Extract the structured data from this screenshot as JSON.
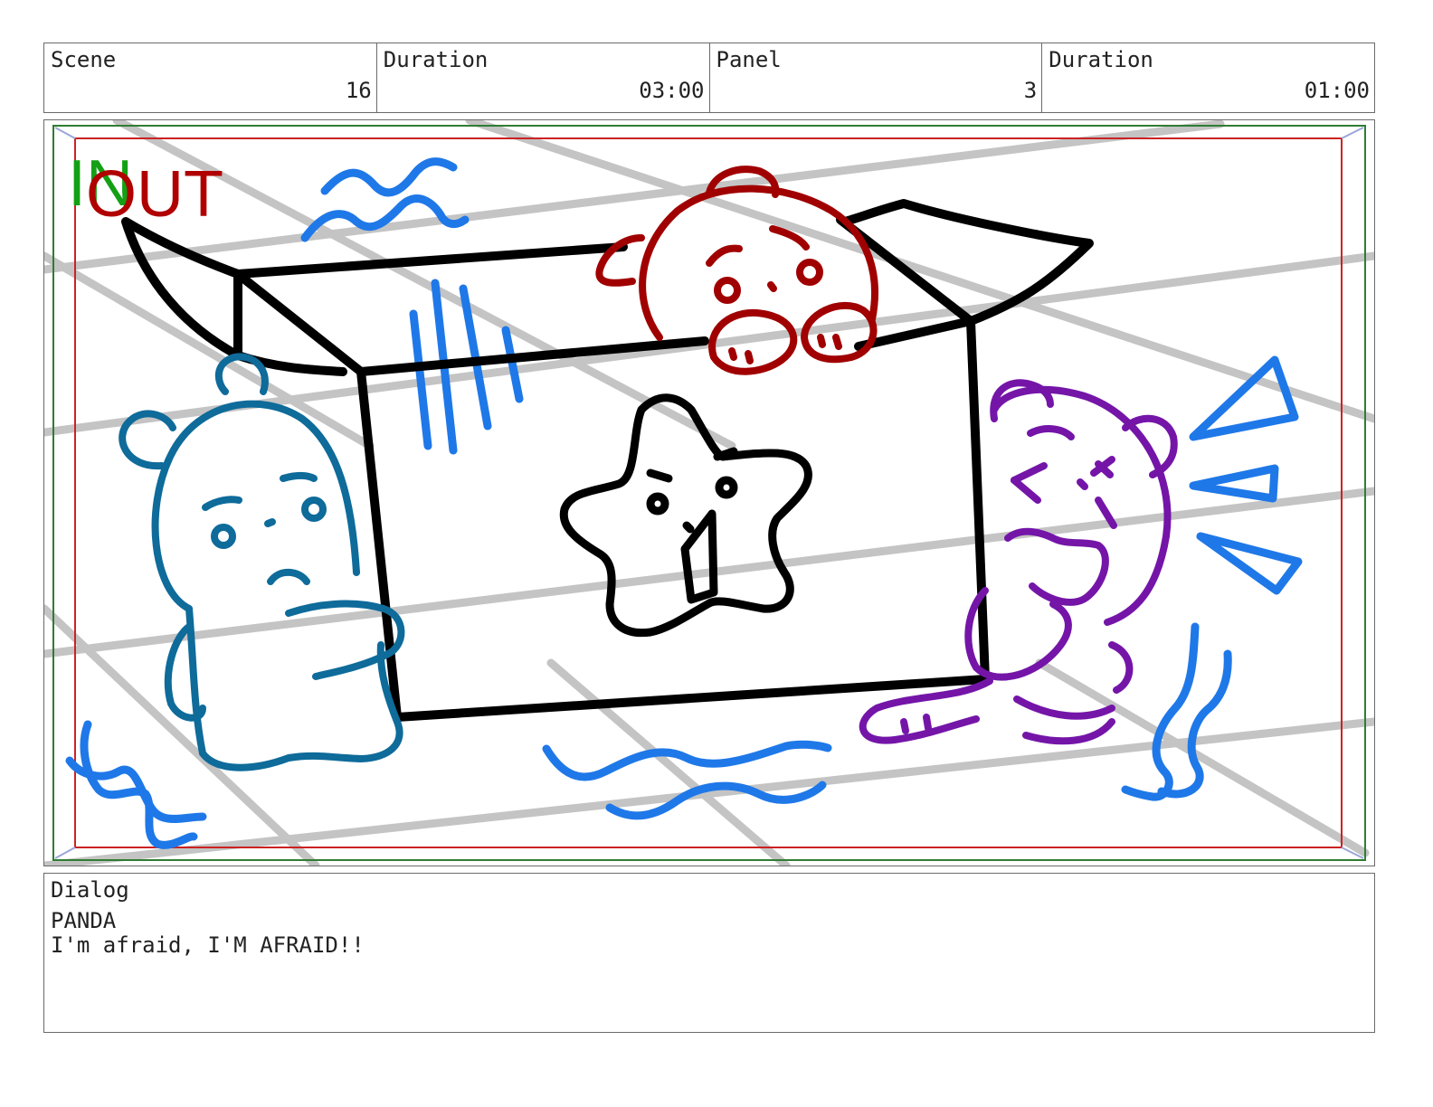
{
  "header": {
    "scene_label": "Scene",
    "scene_value": "16",
    "scene_duration_label": "Duration",
    "scene_duration_value": "03:00",
    "panel_label": "Panel",
    "panel_value": "3",
    "panel_duration_label": "Duration",
    "panel_duration_value": "01:00"
  },
  "panel": {
    "in_marker": "IN",
    "out_marker": "OUT",
    "colors": {
      "in_marker": "#14a014",
      "out_marker": "#b00000",
      "safe_frame": "#cc2222",
      "outer_frame": "#2e7d32",
      "grid": "#c4c4c4",
      "box": "#000000",
      "blue_bear": "#0e6b9a",
      "red_bear": "#a00000",
      "purple_bear": "#7415a8",
      "motion_lines": "#1f78e8"
    },
    "icons": [
      "box-icon",
      "star-face-icon",
      "blue-bear-icon",
      "red-bear-icon",
      "purple-bear-icon",
      "motion-lines-icon",
      "alert-triangles-icon"
    ]
  },
  "dialog": {
    "label": "Dialog",
    "character": "PANDA",
    "line": "I'm afraid, I'M AFRAID!!"
  }
}
